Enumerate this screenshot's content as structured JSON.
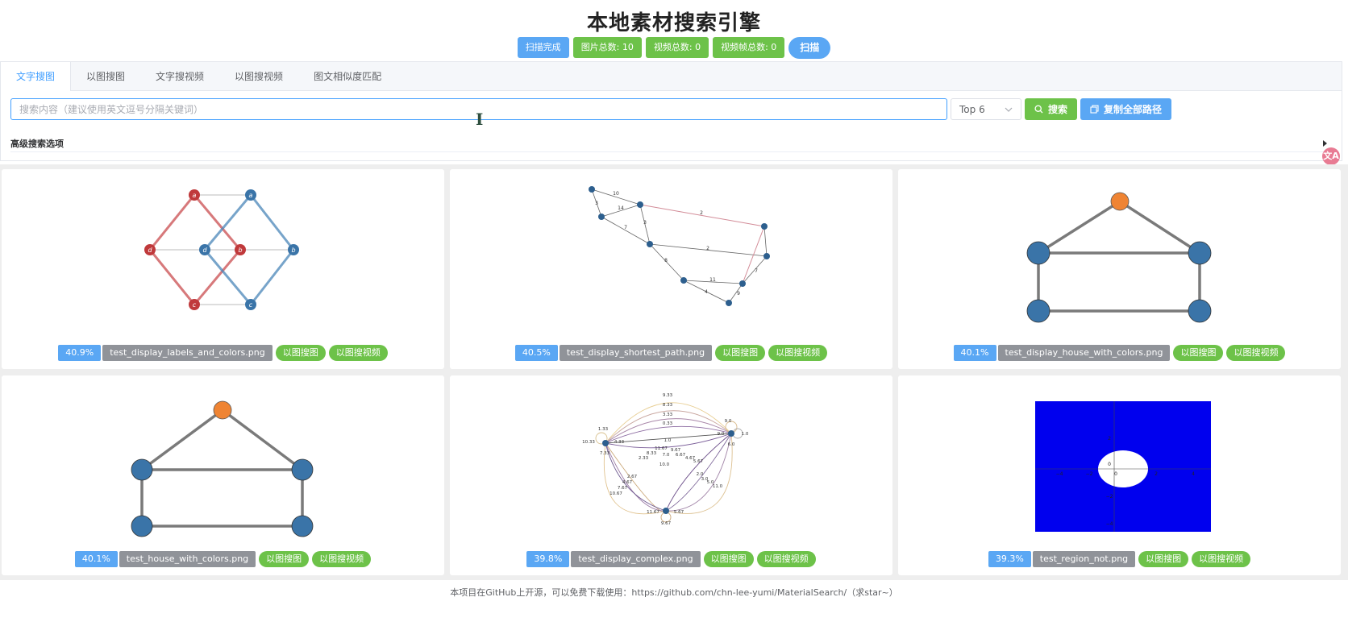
{
  "app": {
    "title": "本地素材搜索引擎"
  },
  "status": {
    "scan_state": "扫描完成",
    "image_total": "图片总数: 10",
    "video_total": "视频总数: 0",
    "frame_total": "视频帧总数: 0",
    "scan_button": "扫描"
  },
  "tabs": [
    "文字搜图",
    "以图搜图",
    "文字搜视频",
    "以图搜视频",
    "图文相似度匹配"
  ],
  "search": {
    "placeholder": "搜索内容（建议使用英文逗号分隔关键词）",
    "value": "",
    "topk": "Top 6",
    "search_button": "搜索",
    "copy_button": "复制全部路径",
    "advanced_label": "高级搜索选项"
  },
  "results": [
    {
      "score": "40.9%",
      "filename": "test_display_labels_and_colors.png",
      "btn_img": "以图搜图",
      "btn_vid": "以图搜视频"
    },
    {
      "score": "40.5%",
      "filename": "test_display_shortest_path.png",
      "btn_img": "以图搜图",
      "btn_vid": "以图搜视频"
    },
    {
      "score": "40.1%",
      "filename": "test_display_house_with_colors.png",
      "btn_img": "以图搜图",
      "btn_vid": "以图搜视频"
    },
    {
      "score": "40.1%",
      "filename": "test_house_with_colors.png",
      "btn_img": "以图搜图",
      "btn_vid": "以图搜视频"
    },
    {
      "score": "39.8%",
      "filename": "test_display_complex.png",
      "btn_img": "以图搜图",
      "btn_vid": "以图搜视频"
    },
    {
      "score": "39.3%",
      "filename": "test_region_not.png",
      "btn_img": "以图搜图",
      "btn_vid": "以图搜视频"
    }
  ],
  "graph_labels": {
    "g1": [
      "a",
      "a",
      "d",
      "d",
      "b",
      "b",
      "c",
      "c"
    ],
    "g2": [
      "10",
      "14",
      "2",
      "2",
      "11",
      "7",
      "4",
      "3",
      "3",
      "8",
      "9",
      "7"
    ],
    "g5": [
      "9.33",
      "8.33",
      "3.33",
      "0.33",
      "1.0",
      "11.67",
      "9.67",
      "8.33",
      "7.0",
      "6.67",
      "4.67",
      "5.67",
      "2.33",
      "10.0",
      "2.0",
      "3.0",
      "5.0",
      "11.0",
      "2.67",
      "4.67",
      "7.67",
      "10.67",
      "11.67",
      "5.67",
      "9.67",
      "10.33",
      "4.33",
      "7.33",
      "9.0",
      "9.0",
      "1.0",
      "6.0",
      "1.33"
    ],
    "g6_ticks": [
      "−2",
      "0",
      "2",
      "4",
      "−4",
      "2",
      "0",
      "−2",
      "−4"
    ]
  },
  "colors": {
    "accent_blue": "#5aa7f4",
    "accent_green": "#6dc249",
    "tag_gray": "#909399",
    "node_blue": "#3a74a8",
    "node_orange": "#ef8433",
    "node_red": "#c0393b",
    "region_blue": "#0000ee"
  },
  "footer": "本项目在GitHub上开源，可以免费下载使用：https://github.com/chn-lee-yumi/MaterialSearch/（求star~）"
}
